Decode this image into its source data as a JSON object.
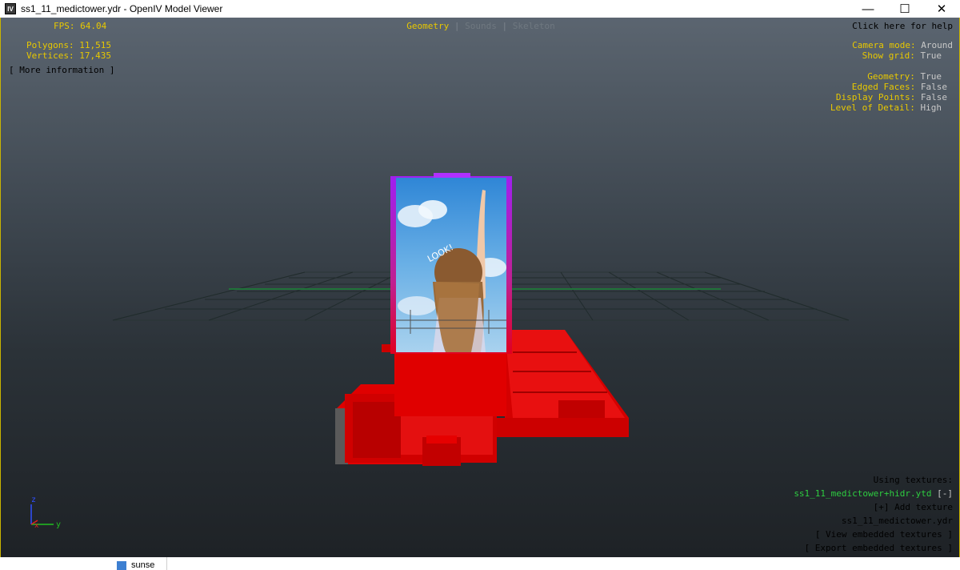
{
  "window": {
    "title": "ss1_11_medictower.ydr - OpenIV Model Viewer",
    "icon_text": "IV"
  },
  "window_controls": {
    "minimize": "—",
    "maximize": "☐",
    "close": "✕"
  },
  "hud_left": {
    "fps_label": "FPS:",
    "fps_value": "64.04",
    "polygons_label": "Polygons:",
    "polygons_value": "11,515",
    "vertices_label": "Vertices:",
    "vertices_value": "17,435",
    "more_info": "[ More information ]"
  },
  "tabs": {
    "geometry": "Geometry",
    "sep1": "|",
    "sounds": "Sounds",
    "sep2": "|",
    "skeleton": "Skeleton"
  },
  "hud_right": {
    "help": "Click here for help",
    "camera_mode_label": "Camera mode:",
    "camera_mode_value": "Around",
    "show_grid_label": "Show grid:",
    "show_grid_value": "True",
    "geometry_label": "Geometry:",
    "geometry_value": "True",
    "edged_faces_label": "Edged Faces:",
    "edged_faces_value": "False",
    "display_points_label": "Display Points:",
    "display_points_value": "False",
    "lod_label": "Level of Detail:",
    "lod_value": "High"
  },
  "textures": {
    "heading": "Using textures:",
    "ytd_name": "ss1_11_medictower+hidr.ytd",
    "ytd_toggle": "[-]",
    "add_texture": "[+] Add texture",
    "ydr_name": "ss1_11_medictower.ydr",
    "view_embedded": "[ View embedded textures ]",
    "export_embedded": "[ Export embedded textures ]"
  },
  "axis": {
    "z": "z",
    "x": "x",
    "y": "y"
  },
  "billboard_text": "LOOK!",
  "bottom": {
    "taskbar_item": "sunse"
  },
  "colors": {
    "hud_yellow": "#e8c800",
    "hud_gray": "#c8c8c8",
    "texture_green": "#2ecc40",
    "model_red": "#e00000",
    "frame_purple": "#9a2cff"
  }
}
